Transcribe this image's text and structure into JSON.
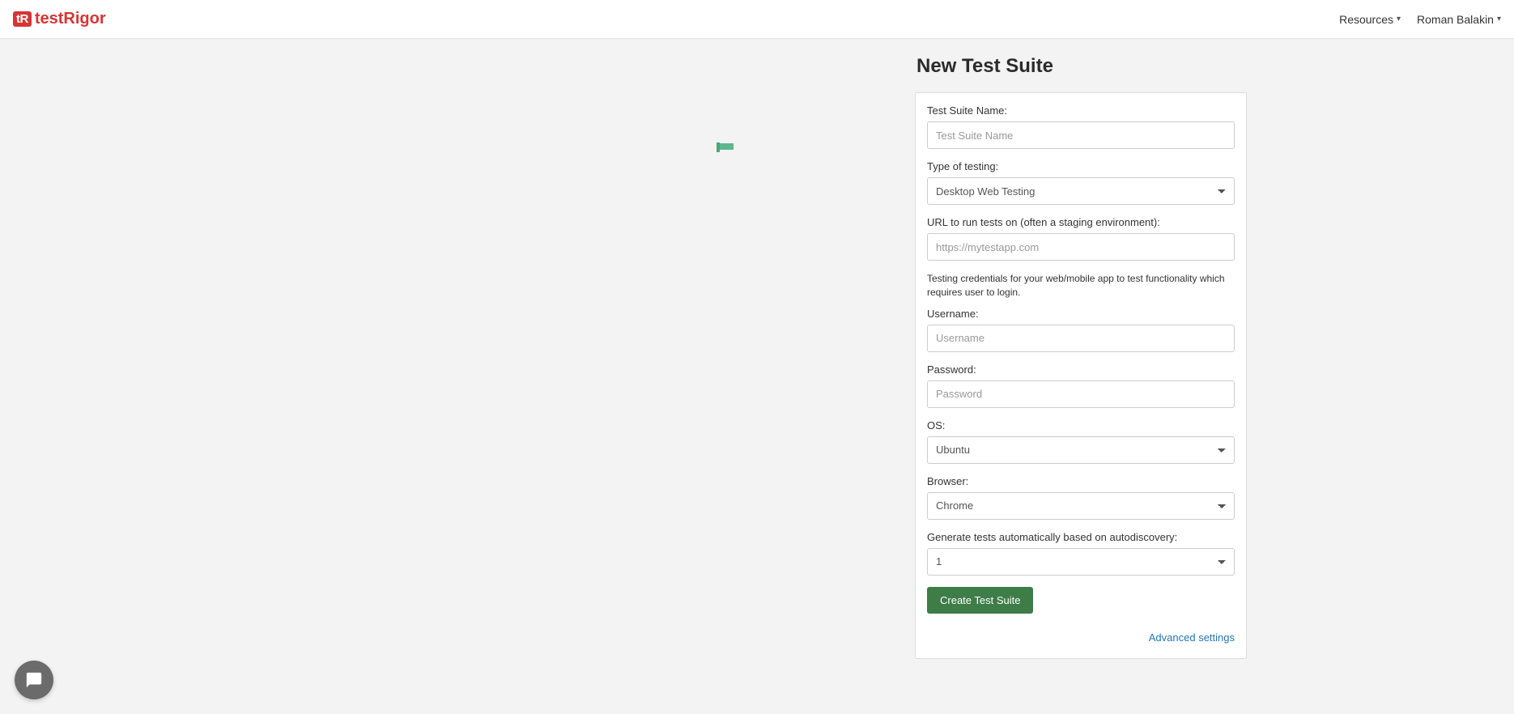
{
  "nav": {
    "brand_prefix": "tR",
    "brand_name": "testRigor",
    "resources_label": "Resources",
    "user_label": "Roman Balakin"
  },
  "page": {
    "title": "New Test Suite"
  },
  "form": {
    "suite_name": {
      "label": "Test Suite Name:",
      "placeholder": "Test Suite Name",
      "value": ""
    },
    "type_of_testing": {
      "label": "Type of testing:",
      "selected": "Desktop Web Testing"
    },
    "url": {
      "label": "URL to run tests on (often a staging environment):",
      "placeholder": "https://mytestapp.com",
      "value": ""
    },
    "credentials_hint": "Testing credentials for your web/mobile app to test functionality which requires user to login.",
    "username": {
      "label": "Username:",
      "placeholder": "Username",
      "value": ""
    },
    "password": {
      "label": "Password:",
      "placeholder": "Password",
      "value": ""
    },
    "os": {
      "label": "OS:",
      "selected": "Ubuntu"
    },
    "browser": {
      "label": "Browser:",
      "selected": "Chrome"
    },
    "autodiscovery": {
      "label": "Generate tests automatically based on autodiscovery:",
      "selected": "1"
    },
    "create_button": "Create Test Suite",
    "advanced_link": "Advanced settings"
  }
}
